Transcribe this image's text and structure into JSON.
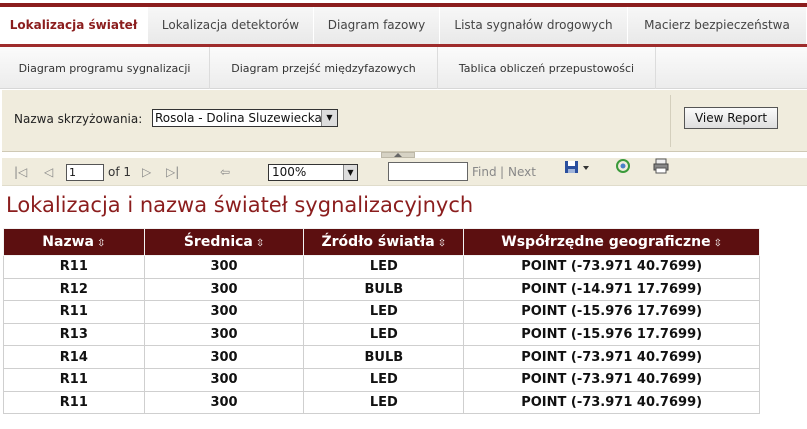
{
  "tabs_primary": [
    {
      "label": "Lokalizacja świateł",
      "active": true
    },
    {
      "label": "Lokalizacja detektorów",
      "active": false
    },
    {
      "label": "Diagram fazowy",
      "active": false
    },
    {
      "label": "Lista sygnałów drogowych",
      "active": false
    },
    {
      "label": "Macierz bezpieczeństwa",
      "active": false
    }
  ],
  "tabs_secondary": [
    {
      "label": "Diagram programu sygnalizacji"
    },
    {
      "label": "Diagram przejść międzyfazowych"
    },
    {
      "label": "Tablica obliczeń przepustowości"
    }
  ],
  "params": {
    "label": "Nazwa skrzyżowania:",
    "intersection_value": "Rosola - Dolina Sluzewiecka",
    "view_report_label": "View Report"
  },
  "toolbar": {
    "page_value": "1",
    "page_of": "of 1",
    "zoom_value": "100%",
    "find_label": "Find",
    "separator": "|",
    "next_label": "Next"
  },
  "report": {
    "title": "Lokalizacja i nazwa świateł sygnalizacyjnych",
    "columns": [
      "Nazwa",
      "Średnica",
      "Źródło światła",
      "Współrzędne geograficzne"
    ],
    "rows": [
      [
        "R11",
        "300",
        "LED",
        "POINT (-73.971 40.7699)"
      ],
      [
        "R12",
        "300",
        "BULB",
        "POINT (-14.971 17.7699)"
      ],
      [
        "R11",
        "300",
        "LED",
        "POINT (-15.976 17.7699)"
      ],
      [
        "R13",
        "300",
        "LED",
        "POINT (-15.976 17.7699)"
      ],
      [
        "R14",
        "300",
        "BULB",
        "POINT (-73.971 40.7699)"
      ],
      [
        "R11",
        "300",
        "LED",
        "POINT (-73.971 40.7699)"
      ],
      [
        "R11",
        "300",
        "LED",
        "POINT (-73.971 40.7699)"
      ]
    ]
  },
  "colors": {
    "brand": "#8b1d1d",
    "header_bg": "#5c0f10",
    "param_bg": "#f0ecdd"
  }
}
